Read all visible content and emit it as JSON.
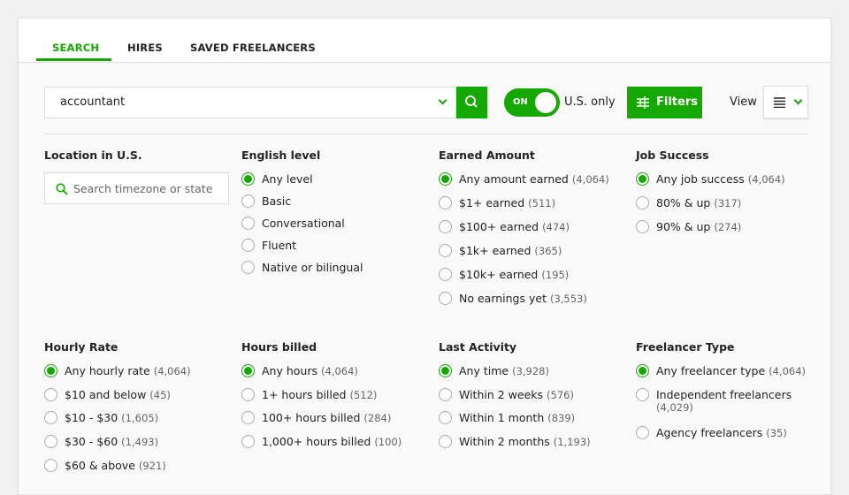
{
  "tabs": [
    {
      "label": "SEARCH",
      "active": true
    },
    {
      "label": "HIRES"
    },
    {
      "label": "SAVED FREELANCERS"
    }
  ],
  "search": {
    "value": "accountant"
  },
  "toggle": {
    "label": "ON",
    "state": true,
    "text": "U.S. only"
  },
  "filters_label": "Filters",
  "view_label": "View",
  "colors": {
    "accent": "#14a800"
  },
  "location": {
    "title": "Location in U.S.",
    "placeholder": "Search timezone or state"
  },
  "groups": [
    {
      "title": "English level",
      "options": [
        {
          "label": "Any level",
          "selected": true
        },
        {
          "label": "Basic"
        },
        {
          "label": "Conversational"
        },
        {
          "label": "Fluent"
        },
        {
          "label": "Native or bilingual"
        }
      ]
    },
    {
      "title": "Earned Amount",
      "options": [
        {
          "label": "Any amount earned",
          "count": "(4,064)",
          "selected": true
        },
        {
          "label": "$1+ earned",
          "count": "(511)"
        },
        {
          "label": "$100+ earned",
          "count": "(474)"
        },
        {
          "label": "$1k+ earned",
          "count": "(365)"
        },
        {
          "label": "$10k+ earned",
          "count": "(195)"
        },
        {
          "label": "No earnings yet",
          "count": "(3,553)"
        }
      ]
    },
    {
      "title": "Job Success",
      "options": [
        {
          "label": "Any job success",
          "count": "(4,064)",
          "selected": true
        },
        {
          "label": "80% & up",
          "count": "(317)"
        },
        {
          "label": "90% & up",
          "count": "(274)"
        }
      ]
    },
    {
      "title": "Hourly Rate",
      "options": [
        {
          "label": "Any hourly rate",
          "count": "(4,064)",
          "selected": true
        },
        {
          "label": "$10 and below",
          "count": "(45)"
        },
        {
          "label": "$10 - $30",
          "count": "(1,605)"
        },
        {
          "label": "$30 - $60",
          "count": "(1,493)"
        },
        {
          "label": "$60 & above",
          "count": "(921)"
        }
      ]
    },
    {
      "title": "Hours billed",
      "options": [
        {
          "label": "Any hours",
          "count": "(4,064)",
          "selected": true
        },
        {
          "label": "1+ hours billed",
          "count": "(512)"
        },
        {
          "label": "100+ hours billed",
          "count": "(284)"
        },
        {
          "label": "1,000+ hours billed",
          "count": "(100)"
        }
      ]
    },
    {
      "title": "Last Activity",
      "options": [
        {
          "label": "Any time",
          "count": "(3,928)",
          "selected": true
        },
        {
          "label": "Within 2 weeks",
          "count": "(576)"
        },
        {
          "label": "Within 1 month",
          "count": "(839)"
        },
        {
          "label": "Within 2 months",
          "count": "(1,193)"
        }
      ]
    },
    {
      "title": "Freelancer Type",
      "options": [
        {
          "label": "Any freelancer type",
          "count": "(4,064)",
          "selected": true
        },
        {
          "label": "Independent freelancers",
          "count": "(4,029)"
        },
        {
          "label": "Agency freelancers",
          "count": "(35)"
        }
      ]
    }
  ]
}
